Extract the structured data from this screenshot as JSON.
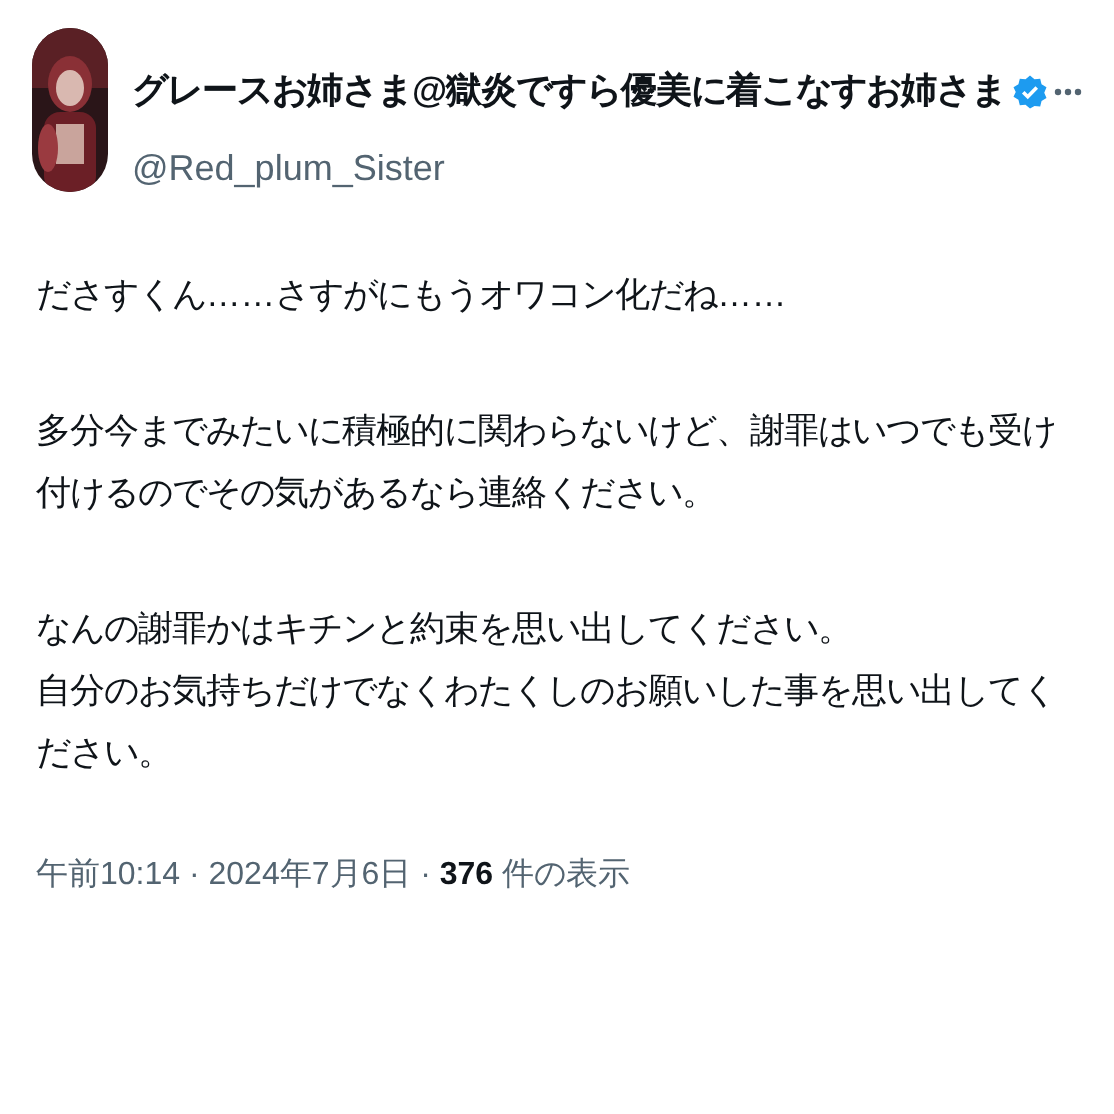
{
  "author": {
    "name": "グレースお姉さま@獄炎ですら優美に着こなすお姉さま",
    "verified": true,
    "handle": "@Red_plum_Sister"
  },
  "paragraphs": [
    [
      "ださすくん……さすがにもうオワコン化だね……"
    ],
    [
      "多分今までみたいに積極的に関わらないけど、謝罪はいつでも受け付けるのでその気があるなら連絡ください。"
    ],
    [
      "なんの謝罪かはキチンと約束を思い出してください。",
      "自分のお気持ちだけでなくわたくしのお願いした事を思い出してください。"
    ]
  ],
  "meta": "午前10:14 · 2024年7月6日 · **376** 件の表示"
}
